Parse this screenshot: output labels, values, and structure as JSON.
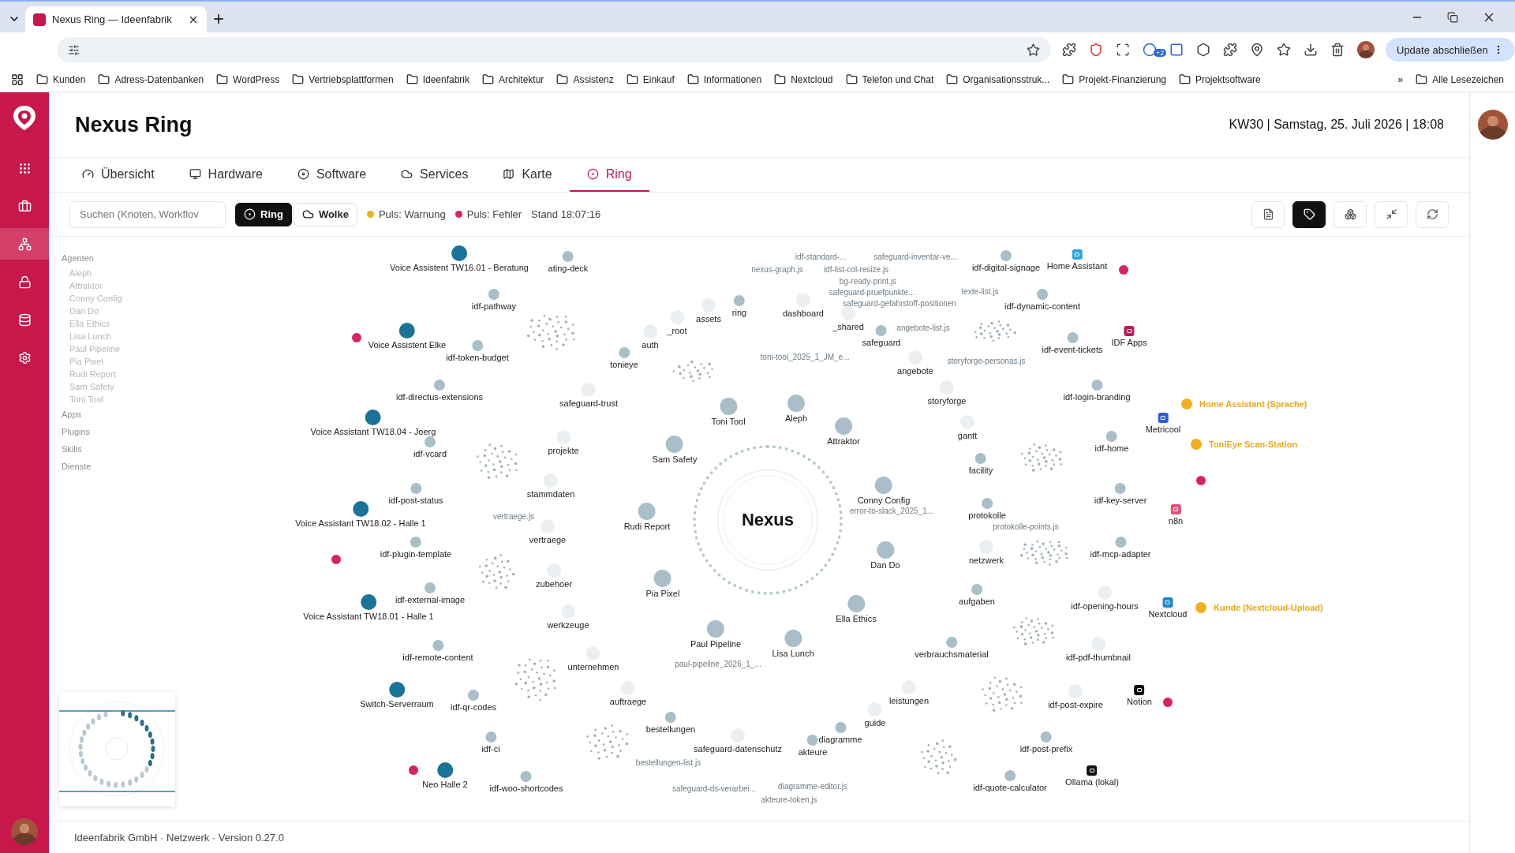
{
  "browser": {
    "tab_title": "Nexus Ring — Ideenfabrik",
    "extension_badge": "+2",
    "update_button": "Update abschließen",
    "bookmarks": [
      "Kunden",
      "Adress-Datenbanken",
      "WordPress",
      "Vertriebsplattformen",
      "Ideenfabrik",
      "Architektur",
      "Assistenz",
      "Einkauf",
      "Informationen",
      "Nextcloud",
      "Telefon und Chat",
      "Organisationsstruk...",
      "Projekt-Finanzierung",
      "Projektsoftware"
    ],
    "more": "»",
    "all_bookmarks": "Alle Lesezeichen"
  },
  "app_nav": [
    {
      "selected": false
    },
    {
      "selected": false
    },
    {
      "selected": true
    },
    {
      "selected": false
    },
    {
      "selected": false
    },
    {
      "selected": false
    }
  ],
  "header": {
    "title": "Nexus Ring",
    "datetime": "KW30 | Samstag, 25. Juli 2026 | 18:08"
  },
  "tabs": [
    {
      "label": "Übersicht",
      "selected": false
    },
    {
      "label": "Hardware",
      "selected": false
    },
    {
      "label": "Software",
      "selected": false
    },
    {
      "label": "Services",
      "selected": false
    },
    {
      "label": "Karte",
      "selected": false
    },
    {
      "label": "Ring",
      "selected": true
    }
  ],
  "toolbar": {
    "search": {
      "placeholder": "Suchen (Knoten, Workflov"
    },
    "view_modes": [
      {
        "label": "Ring",
        "selected": true
      },
      {
        "label": "Wolke",
        "selected": false
      }
    ],
    "legend": [
      {
        "label": "Puls: Warnung",
        "color": "#f2b01e"
      },
      {
        "label": "Puls: Fehler",
        "color": "#d6245c"
      }
    ],
    "timestamp": "Stand 18:07:16",
    "actions": [
      {
        "selected": false
      },
      {
        "selected": true
      },
      {
        "selected": false
      },
      {
        "selected": false
      },
      {
        "selected": false
      }
    ]
  },
  "sidebar": {
    "groups": [
      {
        "label": "Agenten",
        "children": [
          "Aleph",
          "Attraktor",
          "Conny Config",
          "Dan Do",
          "Ella Ethics",
          "Lisa Lunch",
          "Paul Pipeline",
          "Pia Pixel",
          "Rudi Report",
          "Sam Safety",
          "Toni Tool"
        ]
      },
      {
        "label": "Apps"
      },
      {
        "label": "Plugins"
      },
      {
        "label": "Skills"
      },
      {
        "label": "Dienste"
      }
    ]
  },
  "graph": {
    "center": "Nexus",
    "nodes": [
      {
        "label": "Voice Assistent TW16.01 - Beratung",
        "kind": "device"
      },
      {
        "label": "ating-deck",
        "kind": "repo"
      },
      {
        "label": "idf-pathway",
        "kind": "repo"
      },
      {
        "label": "Voice Assistent Elke",
        "kind": "device"
      },
      {
        "kind": "alert"
      },
      {
        "label": "idf-token-budget",
        "kind": "repo"
      },
      {
        "label": "idf-directus-extensions",
        "kind": "repo"
      },
      {
        "label": "Voice Assistant TW18.04 - Joerg",
        "kind": "device"
      },
      {
        "label": "idf-vcard",
        "kind": "repo"
      },
      {
        "label": "idf-post-status",
        "kind": "repo"
      },
      {
        "label": "Voice Assistant TW18.02 - Halle 1",
        "kind": "device"
      },
      {
        "label": "idf-plugin-template",
        "kind": "repo"
      },
      {
        "kind": "alert"
      },
      {
        "label": "idf-external-image",
        "kind": "repo"
      },
      {
        "label": "Voice Assistant TW18.01 - Halle 1",
        "kind": "device"
      },
      {
        "label": "idf-remote-content",
        "kind": "repo"
      },
      {
        "label": "Switch-Serverraum",
        "kind": "device"
      },
      {
        "label": "idf-qr-codes",
        "kind": "repo"
      },
      {
        "label": "idf-ci",
        "kind": "repo"
      },
      {
        "kind": "alert"
      },
      {
        "label": "Neo Halle 2",
        "kind": "device"
      },
      {
        "label": "idf-woo-shortcodes",
        "kind": "repo"
      },
      {
        "label": "tonieye",
        "kind": "repo"
      },
      {
        "label": "auth",
        "kind": "folder"
      },
      {
        "label": "_root",
        "kind": "folder"
      },
      {
        "label": "assets",
        "kind": "folder"
      },
      {
        "label": "ring",
        "kind": "repo"
      },
      {
        "label": "dashboard",
        "kind": "folder"
      },
      {
        "label": "_shared",
        "kind": "folder"
      },
      {
        "label": "safeguard",
        "kind": "repo"
      },
      {
        "label": "nexus-graph.js",
        "kind": "file"
      },
      {
        "label": "idf-standard-...",
        "kind": "file"
      },
      {
        "label": "idf-list-col-resize.js",
        "kind": "file"
      },
      {
        "label": "safeguard-inventar-ve...",
        "kind": "file"
      },
      {
        "label": "bg-ready-print.js",
        "kind": "file"
      },
      {
        "label": "safeguard-pruefpunkte...",
        "kind": "file"
      },
      {
        "label": "safeguard-gefahrstoff-positionen",
        "kind": "file"
      },
      {
        "label": "texte-list.js",
        "kind": "file"
      },
      {
        "label": "angebote-list.js",
        "kind": "file"
      },
      {
        "label": "toni-tool_2025_1_JM_e...",
        "kind": "file"
      },
      {
        "label": "angebote",
        "kind": "folder"
      },
      {
        "label": "storyforge-personas.js",
        "kind": "file"
      },
      {
        "label": "safeguard-trust",
        "kind": "folder"
      },
      {
        "label": "Toni Tool",
        "kind": "agent"
      },
      {
        "label": "Aleph",
        "kind": "agent"
      },
      {
        "label": "storyforge",
        "kind": "folder"
      },
      {
        "label": "Attraktor",
        "kind": "agent"
      },
      {
        "label": "gantt",
        "kind": "folder"
      },
      {
        "label": "projekte",
        "kind": "folder"
      },
      {
        "label": "Sam Safety",
        "kind": "agent"
      },
      {
        "label": "facility",
        "kind": "repo"
      },
      {
        "label": "Conny Config",
        "kind": "agent"
      },
      {
        "label": "error-to-slack_2025_1...",
        "kind": "file"
      },
      {
        "label": "stammdaten",
        "kind": "folder"
      },
      {
        "label": "vertraege.js",
        "kind": "file"
      },
      {
        "label": "Rudi Report",
        "kind": "agent"
      },
      {
        "label": "protokolle",
        "kind": "repo"
      },
      {
        "label": "protokolle-points.js",
        "kind": "file"
      },
      {
        "label": "vertraege",
        "kind": "folder"
      },
      {
        "label": "Dan Do",
        "kind": "agent"
      },
      {
        "label": "netzwerk",
        "kind": "folder"
      },
      {
        "label": "zubehoer",
        "kind": "folder"
      },
      {
        "label": "Pia Pixel",
        "kind": "agent"
      },
      {
        "label": "Ella Ethics",
        "kind": "agent"
      },
      {
        "label": "aufgaben",
        "kind": "repo"
      },
      {
        "label": "werkzeuge",
        "kind": "folder"
      },
      {
        "label": "Paul Pipeline",
        "kind": "agent"
      },
      {
        "label": "Lisa Lunch",
        "kind": "agent"
      },
      {
        "label": "paul-pipeline_2026_1_...",
        "kind": "file"
      },
      {
        "label": "verbrauchsmaterial",
        "kind": "repo"
      },
      {
        "label": "unternehmen",
        "kind": "folder"
      },
      {
        "label": "auftraege",
        "kind": "folder"
      },
      {
        "label": "leistungen",
        "kind": "folder"
      },
      {
        "label": "bestellungen",
        "kind": "repo"
      },
      {
        "label": "guide",
        "kind": "folder"
      },
      {
        "label": "diagramme",
        "kind": "repo"
      },
      {
        "label": "safeguard-datenschutz",
        "kind": "folder"
      },
      {
        "label": "akteure",
        "kind": "repo"
      },
      {
        "label": "bestellungen-list.js",
        "kind": "file"
      },
      {
        "label": "safeguard-ds-verarbei...",
        "kind": "file"
      },
      {
        "label": "diagramme-editor.js",
        "kind": "file"
      },
      {
        "label": "akteure-token.js",
        "kind": "file"
      },
      {
        "label": "idf-digital-signage",
        "kind": "repo"
      },
      {
        "label": "Home Assistant",
        "kind": "service",
        "color": "#29a9e0"
      },
      {
        "kind": "alert"
      },
      {
        "label": "idf-dynamic-content",
        "kind": "repo"
      },
      {
        "label": "IDF Apps",
        "kind": "service",
        "color": "#c2185b"
      },
      {
        "label": "idf-event-tickets",
        "kind": "repo"
      },
      {
        "label": "idf-login-branding",
        "kind": "repo"
      },
      {
        "label": "Home Assistant (Sprache)",
        "kind": "sensor"
      },
      {
        "label": "Metricool",
        "kind": "service",
        "color": "#2d5bd8"
      },
      {
        "label": "idf-home",
        "kind": "repo"
      },
      {
        "label": "ToniEye Scan-Station",
        "kind": "sensor"
      },
      {
        "kind": "alert"
      },
      {
        "label": "idf-key-server",
        "kind": "repo"
      },
      {
        "label": "n8n",
        "kind": "service",
        "color": "#e0527a"
      },
      {
        "label": "idf-mcp-adapter",
        "kind": "repo"
      },
      {
        "label": "idf-opening-hours",
        "kind": "folder"
      },
      {
        "label": "Nextcloud",
        "kind": "service",
        "color": "#1e88c8"
      },
      {
        "label": "Kunde (Nextcloud-Upload)",
        "kind": "sensor"
      },
      {
        "label": "idf-pdf-thumbnail",
        "kind": "folder"
      },
      {
        "label": "idf-post-expire",
        "kind": "folder"
      },
      {
        "label": "Notion",
        "kind": "service",
        "color": "#111111"
      },
      {
        "kind": "alert"
      },
      {
        "label": "idf-post-prefix",
        "kind": "repo"
      },
      {
        "label": "Ollama (lokal)",
        "kind": "service",
        "color": "#111111"
      },
      {
        "label": "idf-quote-calculator",
        "kind": "repo"
      }
    ]
  },
  "footer": "Ideenfabrik GmbH · Netzwerk · Version 0.27.0"
}
